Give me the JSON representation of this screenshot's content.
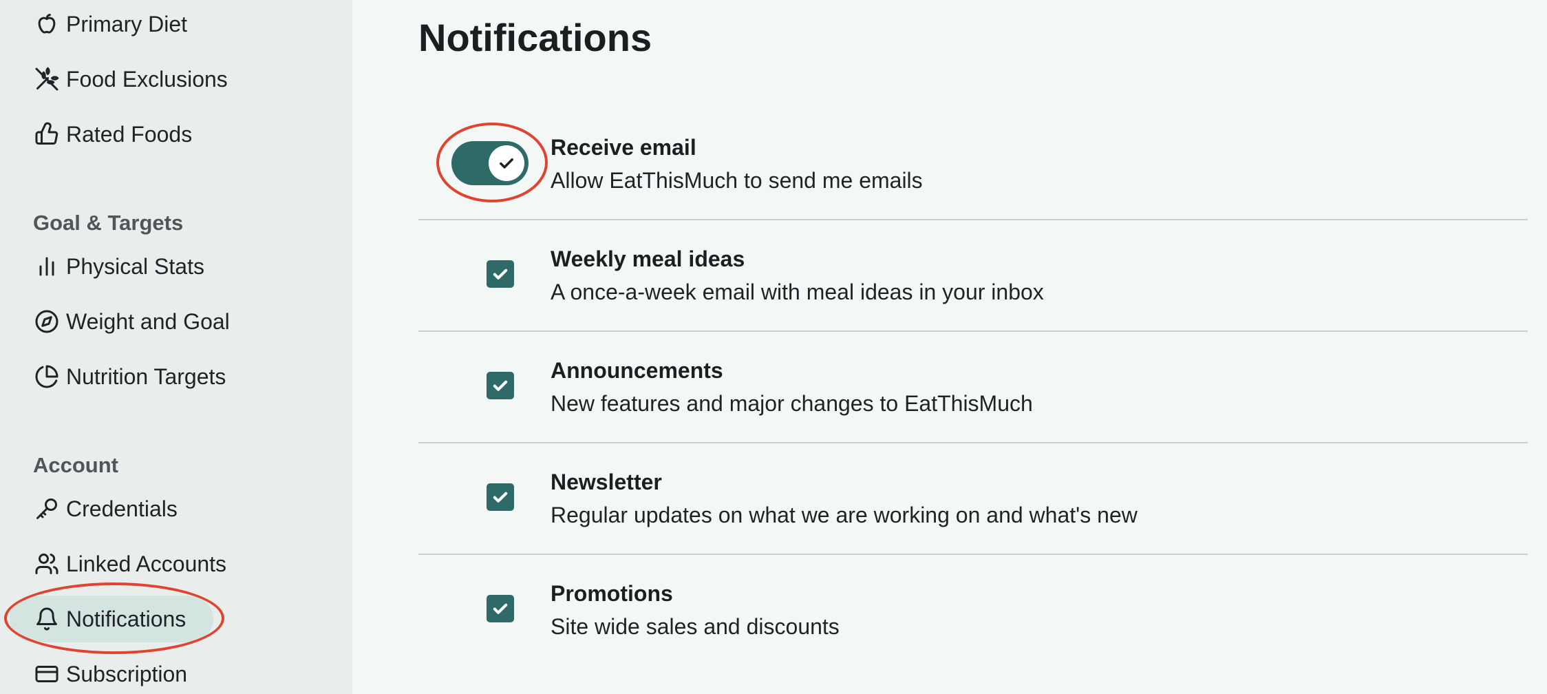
{
  "sidebar": {
    "items_top": [
      {
        "label": "Primary Diet",
        "icon": "apple-icon"
      },
      {
        "label": "Food Exclusions",
        "icon": "wheat-off-icon"
      },
      {
        "label": "Rated Foods",
        "icon": "thumbs-up-icon"
      }
    ],
    "goal_section_title": "Goal & Targets",
    "items_goal": [
      {
        "label": "Physical Stats",
        "icon": "bar-chart-icon"
      },
      {
        "label": "Weight and Goal",
        "icon": "compass-icon"
      },
      {
        "label": "Nutrition Targets",
        "icon": "pie-chart-icon"
      }
    ],
    "account_section_title": "Account",
    "items_account": [
      {
        "label": "Credentials",
        "icon": "key-icon"
      },
      {
        "label": "Linked Accounts",
        "icon": "users-icon"
      },
      {
        "label": "Notifications",
        "icon": "bell-icon",
        "active": true
      },
      {
        "label": "Subscription",
        "icon": "credit-card-icon"
      }
    ]
  },
  "main": {
    "title": "Notifications",
    "receive_email": {
      "title": "Receive email",
      "description": "Allow EatThisMuch to send me emails",
      "enabled": true
    },
    "options": [
      {
        "title": "Weekly meal ideas",
        "description": "A once-a-week email with meal ideas in your inbox",
        "checked": true
      },
      {
        "title": "Announcements",
        "description": "New features and major changes to EatThisMuch",
        "checked": true
      },
      {
        "title": "Newsletter",
        "description": "Regular updates on what we are working on and what's new",
        "checked": true
      },
      {
        "title": "Promotions",
        "description": "Site wide sales and discounts",
        "checked": true
      }
    ]
  },
  "colors": {
    "accent": "#2d6a68",
    "sidebar_bg": "#e9eeec",
    "main_bg": "#f3f7f6",
    "active_pill": "#d4e5e1",
    "annotation_ring": "#e0432f"
  }
}
